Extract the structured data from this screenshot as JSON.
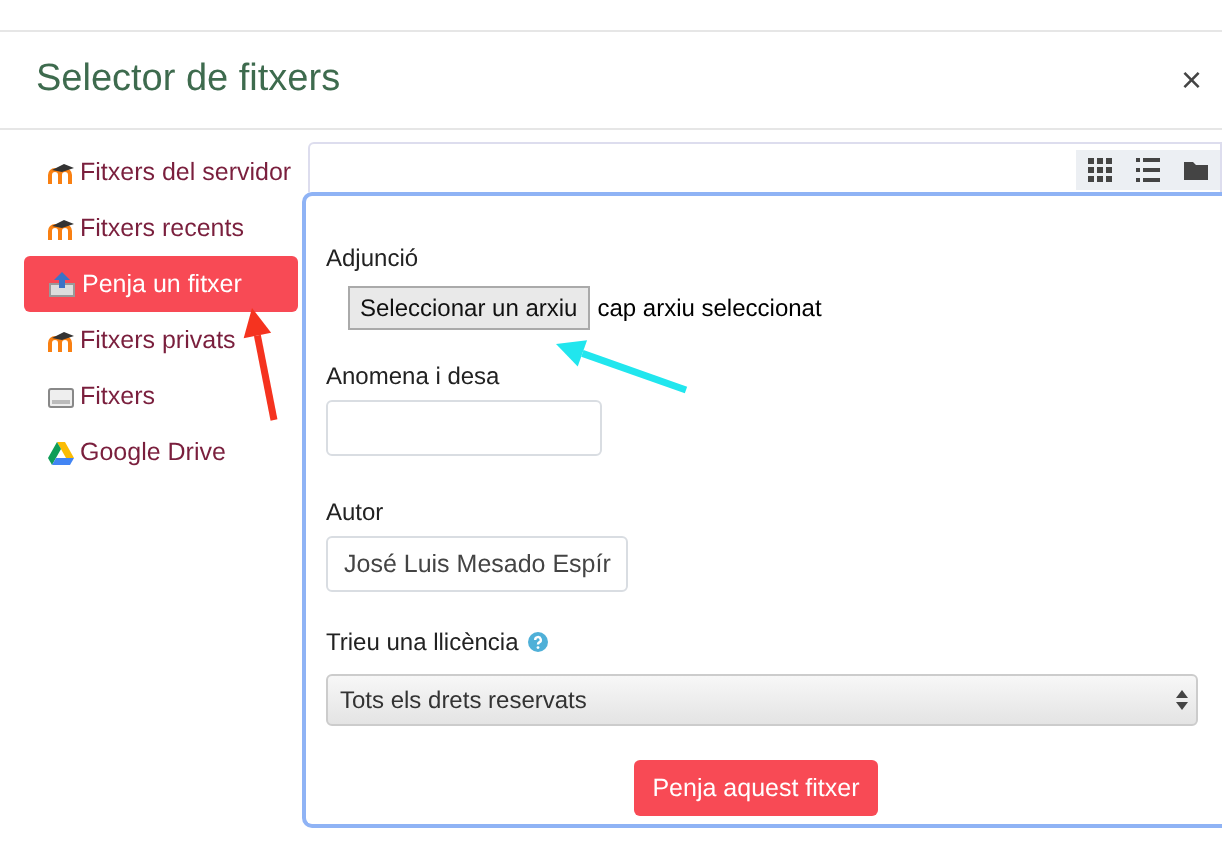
{
  "dialog": {
    "title": "Selector de fitxers",
    "close": "×"
  },
  "sidebar": {
    "items": [
      {
        "label": "Fitxers del servidor",
        "kind": "moodle",
        "selected": false
      },
      {
        "label": "Fitxers recents",
        "kind": "moodle",
        "selected": false
      },
      {
        "label": "Penja un fitxer",
        "kind": "upload",
        "selected": true
      },
      {
        "label": "Fitxers privats",
        "kind": "moodle",
        "selected": false
      },
      {
        "label": "Fitxers",
        "kind": "drive-box",
        "selected": false
      },
      {
        "label": "Google Drive",
        "kind": "gdrive",
        "selected": false
      }
    ]
  },
  "toolbar": {
    "views": [
      {
        "kind": "grid"
      },
      {
        "kind": "list"
      },
      {
        "kind": "folder"
      }
    ]
  },
  "form": {
    "fields": [
      {
        "kind": "file",
        "label": "Adjunció",
        "button": "Seleccionar un arxiu",
        "status": "cap arxiu seleccionat"
      },
      {
        "kind": "text",
        "label": "Anomena i desa"
      },
      {
        "kind": "text",
        "label": "Autor",
        "value": "José Luis Mesado Espír"
      },
      {
        "kind": "select",
        "label": "Trieu una llicència",
        "help": true,
        "value": "Tots els drets reservats"
      }
    ],
    "submit": "Penja aquest fitxer"
  },
  "annotations": [
    {
      "kind": "arrow",
      "color": "#f5331f"
    },
    {
      "kind": "arrow",
      "color": "#21e6ee"
    }
  ]
}
